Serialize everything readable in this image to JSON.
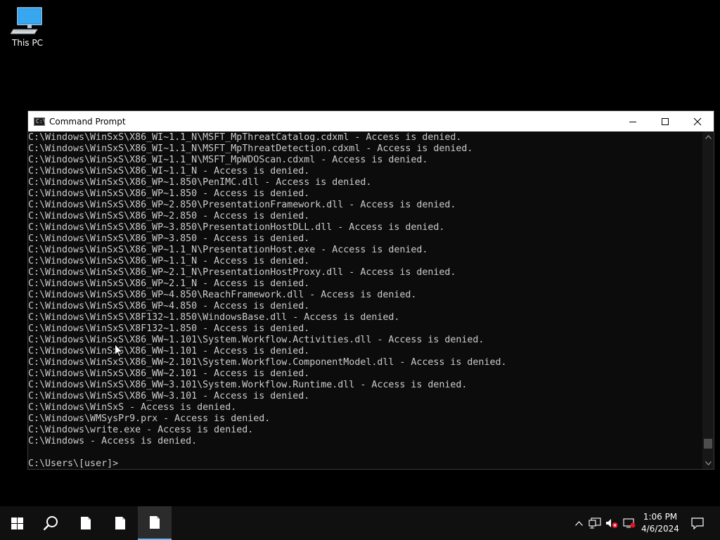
{
  "desktop": {
    "icons": [
      {
        "label": "This PC",
        "icon": "this-pc-icon"
      }
    ]
  },
  "window": {
    "title": "Command Prompt",
    "icon": "cmd-icon",
    "icon_glyph": "C:\\",
    "controls": [
      "minimize",
      "maximize",
      "close"
    ]
  },
  "console": {
    "lines": [
      "C:\\Windows\\WinSxS\\X86_WI~1.1_N\\MSFT_MpThreatCatalog.cdxml - Access is denied.",
      "C:\\Windows\\WinSxS\\X86_WI~1.1_N\\MSFT_MpThreatDetection.cdxml - Access is denied.",
      "C:\\Windows\\WinSxS\\X86_WI~1.1_N\\MSFT_MpWDOScan.cdxml - Access is denied.",
      "C:\\Windows\\WinSxS\\X86_WI~1.1_N - Access is denied.",
      "C:\\Windows\\WinSxS\\X86_WP~1.850\\PenIMC.dll - Access is denied.",
      "C:\\Windows\\WinSxS\\X86_WP~1.850 - Access is denied.",
      "C:\\Windows\\WinSxS\\X86_WP~2.850\\PresentationFramework.dll - Access is denied.",
      "C:\\Windows\\WinSxS\\X86_WP~2.850 - Access is denied.",
      "C:\\Windows\\WinSxS\\X86_WP~3.850\\PresentationHostDLL.dll - Access is denied.",
      "C:\\Windows\\WinSxS\\X86_WP~3.850 - Access is denied.",
      "C:\\Windows\\WinSxS\\X86_WP~1.1_N\\PresentationHost.exe - Access is denied.",
      "C:\\Windows\\WinSxS\\X86_WP~1.1_N - Access is denied.",
      "C:\\Windows\\WinSxS\\X86_WP~2.1_N\\PresentationHostProxy.dll - Access is denied.",
      "C:\\Windows\\WinSxS\\X86_WP~2.1_N - Access is denied.",
      "C:\\Windows\\WinSxS\\X86_WP~4.850\\ReachFramework.dll - Access is denied.",
      "C:\\Windows\\WinSxS\\X86_WP~4.850 - Access is denied.",
      "C:\\Windows\\WinSxS\\X8F132~1.850\\WindowsBase.dll - Access is denied.",
      "C:\\Windows\\WinSxS\\X8F132~1.850 - Access is denied.",
      "C:\\Windows\\WinSxS\\X86_WW~1.101\\System.Workflow.Activities.dll - Access is denied.",
      "C:\\Windows\\WinSxS\\X86_WW~1.101 - Access is denied.",
      "C:\\Windows\\WinSxS\\X86_WW~2.101\\System.Workflow.ComponentModel.dll - Access is denied.",
      "C:\\Windows\\WinSxS\\X86_WW~2.101 - Access is denied.",
      "C:\\Windows\\WinSxS\\X86_WW~3.101\\System.Workflow.Runtime.dll - Access is denied.",
      "C:\\Windows\\WinSxS\\X86_WW~3.101 - Access is denied.",
      "C:\\Windows\\WinSxS - Access is denied.",
      "C:\\Windows\\WMSysPr9.prx - Access is denied.",
      "C:\\Windows\\write.exe - Access is denied.",
      "C:\\Windows - Access is denied.",
      "",
      "C:\\Users\\[user]>"
    ]
  },
  "scrollbar": {
    "position": 0.97
  },
  "taskbar": {
    "buttons": [
      {
        "name": "start-button",
        "icon": "windows-logo-icon"
      },
      {
        "name": "search-button",
        "icon": "search-icon"
      },
      {
        "name": "taskbar-file-1",
        "icon": "file-icon"
      },
      {
        "name": "taskbar-file-2",
        "icon": "file-icon"
      },
      {
        "name": "taskbar-file-3",
        "icon": "file-icon",
        "active": true
      }
    ],
    "tray": [
      "chevron-up-icon",
      "network-icon",
      "volume-muted-icon",
      "display-icon",
      "notification-icon"
    ],
    "clock": {
      "time": "1:06 PM",
      "date": "4/6/2024"
    }
  },
  "colors": {
    "console_bg": "#0c0c0c",
    "console_text": "#cccccc",
    "taskbar_bg": "#101010",
    "accent": "#76b9ed"
  }
}
